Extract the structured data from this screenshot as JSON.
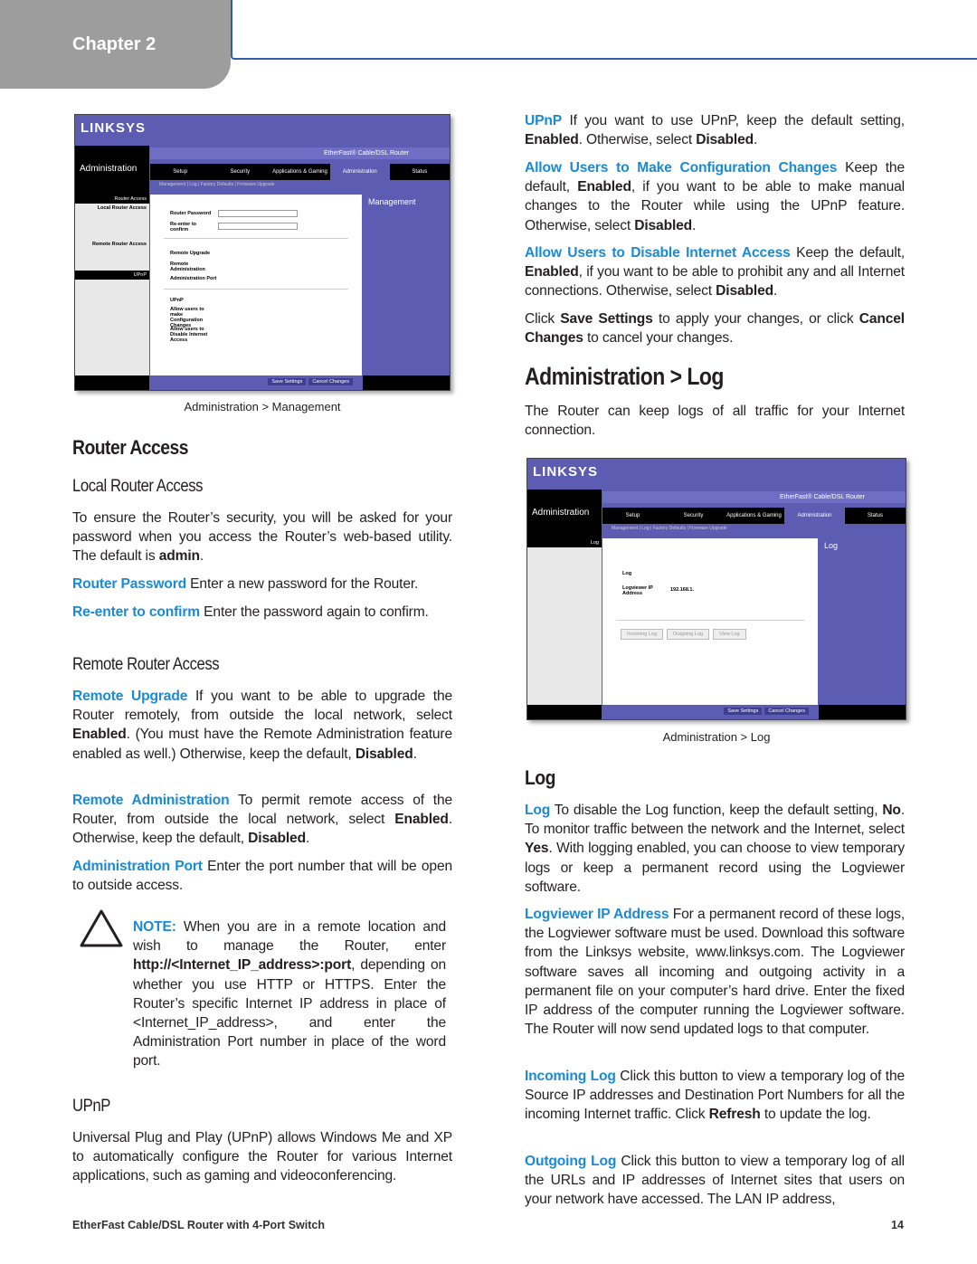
{
  "header": {
    "chapter": "Chapter 2"
  },
  "figure1": {
    "logo": "LINKSYS",
    "section": "Administration",
    "product": "EtherFast® Cable/DSL Router",
    "tabs": [
      "Setup",
      "Security",
      "Applications & Gaming",
      "Administration",
      "Status"
    ],
    "subtabs": "Management  |  Log  |  Factory Defaults  |  Firmware Upgrade",
    "left_labels": [
      "Router Access",
      "Local Router Access",
      "Remote Router Access",
      "UPnP"
    ],
    "rows": [
      "Router Password",
      "Re-enter to confirm",
      "Remote Upgrade",
      "Remote Administration",
      "Administration Port",
      "UPnP",
      "Allow users to make Configuration Changes",
      "Allow users to Disable Internet Access"
    ],
    "help_title": "Management",
    "buttons": [
      "Save Settings",
      "Cancel Changes"
    ],
    "caption": "Administration > Management"
  },
  "figure2": {
    "logo": "LINKSYS",
    "section": "Administration",
    "product": "EtherFast® Cable/DSL Router",
    "tabs": [
      "Setup",
      "Security",
      "Applications & Gaming",
      "Administration",
      "Status"
    ],
    "subtabs": "Management  |  Log  |  Factory Defaults  |  Firmware Upgrade",
    "left_label": "Log",
    "rows": [
      "Log",
      "Logviewer IP Address"
    ],
    "ip_prefix": "192.168.1.",
    "log_buttons": [
      "Incoming Log",
      "Outgoing Log",
      "View Log"
    ],
    "help_title": "Log",
    "buttons": [
      "Save Settings",
      "Cancel Changes"
    ],
    "caption": "Administration > Log"
  },
  "left": {
    "h_router_access": "Router Access",
    "h_local": "Local Router Access",
    "p_intro": [
      {
        "t": "To ensure the Router’s security, you will be asked for your password when you access the Router’s web-based utility. The default is "
      },
      {
        "t": "admin",
        "s": "b"
      },
      {
        "t": "."
      }
    ],
    "p_router_password": [
      {
        "t": "Router Password",
        "s": "l"
      },
      {
        "t": "  Enter a new password for the Router."
      }
    ],
    "p_reenter": [
      {
        "t": "Re-enter to confirm",
        "s": "l"
      },
      {
        "t": "  Enter the password again to confirm."
      }
    ],
    "h_remote": "Remote Router Access",
    "p_remote_upgrade": [
      {
        "t": "Remote Upgrade",
        "s": "l"
      },
      {
        "t": "  If you want to be able to upgrade the Router remotely, from outside the local network, select "
      },
      {
        "t": "Enabled",
        "s": "b"
      },
      {
        "t": ". (You must have the Remote Administration feature enabled as well.) Otherwise, keep the default, "
      },
      {
        "t": "Disabled",
        "s": "b"
      },
      {
        "t": "."
      }
    ],
    "p_remote_admin": [
      {
        "t": "Remote Administration",
        "s": "l"
      },
      {
        "t": "  To permit remote access of the Router, from outside the local network, select "
      },
      {
        "t": "Enabled",
        "s": "b"
      },
      {
        "t": ". Otherwise, keep the default, "
      },
      {
        "t": "Disabled",
        "s": "b"
      },
      {
        "t": "."
      }
    ],
    "p_admin_port": [
      {
        "t": "Administration Port",
        "s": "l"
      },
      {
        "t": "  Enter the port number that will be open to outside access."
      }
    ],
    "note": [
      {
        "t": "NOTE:",
        "s": "l"
      },
      {
        "t": " When you are in a remote location and wish to manage the Router, enter "
      },
      {
        "t": "http://<Internet_IP_address>:port",
        "s": "b"
      },
      {
        "t": ", depending on whether you use HTTP or HTTPS. Enter the Router’s specific Internet IP address in place of <Internet_IP_address>, and enter the Administration Port number in place of the word port."
      }
    ],
    "h_upnp": "UPnP",
    "p_upnp": [
      {
        "t": "Universal Plug and Play (UPnP) allows Windows Me and XP to automatically configure the Router for various Internet applications, such as gaming and videoconferencing."
      }
    ]
  },
  "right": {
    "p_upnp": [
      {
        "t": "UPnP",
        "s": "l"
      },
      {
        "t": "  If you want to use UPnP, keep the default setting, "
      },
      {
        "t": "Enabled",
        "s": "b"
      },
      {
        "t": ". Otherwise, select "
      },
      {
        "t": "Disabled",
        "s": "b"
      },
      {
        "t": "."
      }
    ],
    "p_allow_config": [
      {
        "t": "Allow Users to Make Configuration Changes",
        "s": "l"
      },
      {
        "t": "  Keep the default, "
      },
      {
        "t": "Enabled",
        "s": "b"
      },
      {
        "t": ", if you want to be able to make manual changes to the Router while using the UPnP feature. Otherwise, select "
      },
      {
        "t": "Disabled",
        "s": "b"
      },
      {
        "t": "."
      }
    ],
    "p_allow_disable": [
      {
        "t": "Allow Users to Disable Internet Access",
        "s": "l"
      },
      {
        "t": "  Keep the default, "
      },
      {
        "t": "Enabled",
        "s": "b"
      },
      {
        "t": ", if you want to be able to prohibit any and all Internet connections. Otherwise, select "
      },
      {
        "t": "Disabled",
        "s": "b"
      },
      {
        "t": "."
      }
    ],
    "p_save": [
      {
        "t": "Click "
      },
      {
        "t": "Save Settings",
        "s": "b"
      },
      {
        "t": " to apply your changes, or click "
      },
      {
        "t": "Cancel Changes",
        "s": "b"
      },
      {
        "t": " to cancel your changes."
      }
    ],
    "h_admin_log": "Administration > Log",
    "p_log_intro": [
      {
        "t": "The Router can keep logs of all traffic for your Internet connection."
      }
    ],
    "h_log": "Log",
    "p_log": [
      {
        "t": "Log",
        "s": "l"
      },
      {
        "t": "  To disable the Log function, keep the default setting, "
      },
      {
        "t": "No",
        "s": "b"
      },
      {
        "t": ". To monitor traffic between the network and the Internet, select "
      },
      {
        "t": "Yes",
        "s": "b"
      },
      {
        "t": ". With logging enabled, you can choose to view temporary logs or keep a permanent record using the Logviewer software."
      }
    ],
    "p_logviewer": [
      {
        "t": "Logviewer IP Address",
        "s": "l"
      },
      {
        "t": "  For a permanent record of these logs, the Logviewer software must be used. Download this software from the Linksys website, www.linksys.com. The Logviewer software saves all incoming and outgoing activity in a permanent file on your computer’s hard drive. Enter the fixed IP address of the computer running the Logviewer software. The Router will now send updated logs to that computer."
      }
    ],
    "p_incoming": [
      {
        "t": "Incoming Log",
        "s": "l"
      },
      {
        "t": "  Click this button to view a temporary log of the Source IP addresses and Destination Port Numbers for all the incoming Internet traffic. Click "
      },
      {
        "t": "Refresh",
        "s": "b"
      },
      {
        "t": " to update the log."
      }
    ],
    "p_outgoing": [
      {
        "t": "Outgoing Log",
        "s": "l"
      },
      {
        "t": "  Click this button to view a temporary log of all the URLs and IP addresses of Internet sites that users on your network have accessed. The LAN IP address,"
      }
    ]
  },
  "footer": {
    "title": "EtherFast Cable/DSL Router with 4-Port Switch",
    "page": "14"
  },
  "colors": {
    "link": "#1c8ad2",
    "chapter_tab": "#9d9d9d",
    "frame": "#2f5fa8",
    "ui_purple": "#5b5cb2"
  }
}
